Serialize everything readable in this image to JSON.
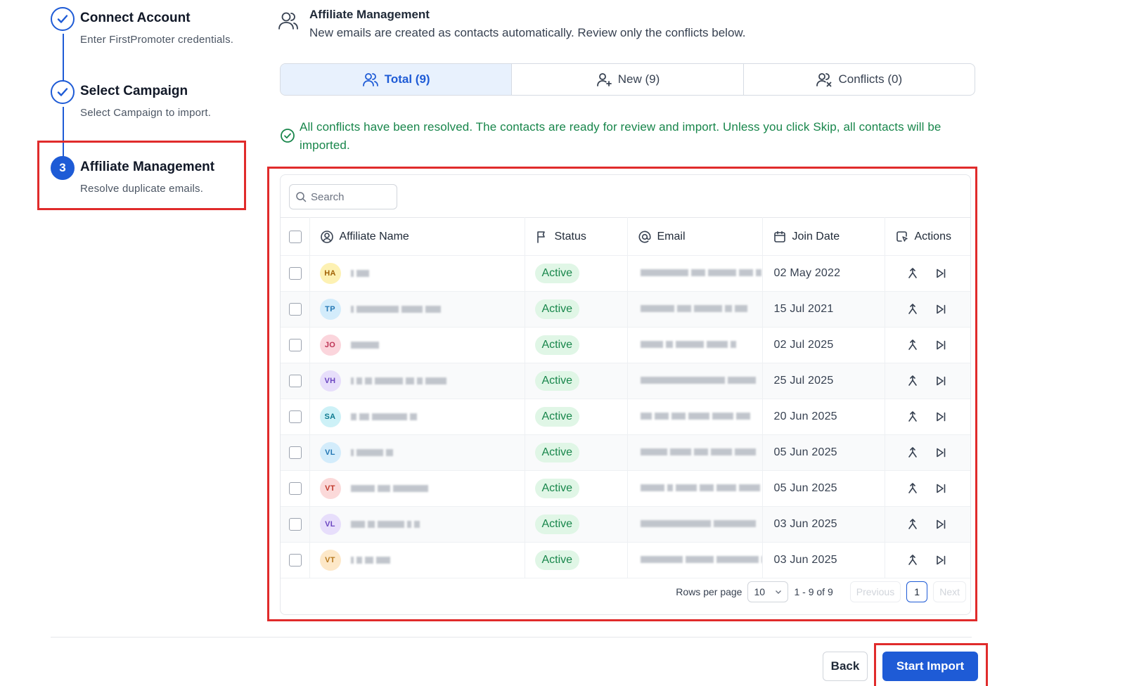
{
  "stepper": {
    "steps": [
      {
        "title": "Connect Account",
        "desc": "Enter FirstPromoter credentials.",
        "state": "completed"
      },
      {
        "title": "Select Campaign",
        "desc": "Select Campaign to import.",
        "state": "completed"
      },
      {
        "number": "3",
        "title": "Affiliate Management",
        "desc": "Resolve duplicate emails.",
        "state": "active"
      }
    ]
  },
  "header": {
    "icon": "users-icon",
    "title": "Affiliate Management",
    "subtitle": "New emails are created as contacts automatically. Review only the conflicts below."
  },
  "tabs": [
    {
      "label": "Total (9)",
      "icon": "users-icon",
      "active": true
    },
    {
      "label": "New (9)",
      "icon": "user-plus-icon",
      "active": false
    },
    {
      "label": "Conflicts (0)",
      "icon": "user-x-icon",
      "active": false
    }
  ],
  "notice": {
    "icon": "check-circle-icon",
    "text": "All conflicts have been resolved. The contacts are ready for review and import. Unless you click Skip, all contacts will be imported."
  },
  "search": {
    "placeholder": "Search"
  },
  "table": {
    "columns": [
      "Affiliate Name",
      "Status",
      "Email",
      "Join Date",
      "Actions"
    ],
    "rows": [
      {
        "initials": "HA",
        "status": "Active",
        "join_date": "02 May 2022"
      },
      {
        "initials": "TP",
        "status": "Active",
        "join_date": "15 Jul 2021"
      },
      {
        "initials": "JO",
        "status": "Active",
        "join_date": "02 Jul 2025"
      },
      {
        "initials": "VH",
        "status": "Active",
        "join_date": "25 Jul 2025"
      },
      {
        "initials": "SA",
        "status": "Active",
        "join_date": "20 Jun 2025"
      },
      {
        "initials": "VL",
        "status": "Active",
        "join_date": "05 Jun 2025"
      },
      {
        "initials": "VT",
        "status": "Active",
        "join_date": "05 Jun 2025"
      },
      {
        "initials": "VL",
        "status": "Active",
        "join_date": "03 Jun 2025"
      },
      {
        "initials": "VT",
        "status": "Active",
        "join_date": "03 Jun 2025"
      }
    ]
  },
  "pagination": {
    "rows_label": "Rows per page",
    "rows_value": "10",
    "range": "1 - 9 of 9",
    "previous": "Previous",
    "current_page": "1",
    "next": "Next"
  },
  "footer": {
    "back": "Back",
    "start_import": "Start Import"
  },
  "colors": {
    "accent": "#1e5bd6",
    "success": "#18864b",
    "highlight": "#e02b2b",
    "avatars": {
      "HA": [
        "#fdf1b3",
        "#a16207"
      ],
      "TP": [
        "#d3ecfb",
        "#2478b5"
      ],
      "JO": [
        "#fbd5dc",
        "#be3455"
      ],
      "VH": [
        "#e7defb",
        "#6b46c1"
      ],
      "SA": [
        "#cdf1f7",
        "#0e7a90"
      ],
      "VL": [
        "#d3ecfb",
        "#2478b5"
      ],
      "VT": [
        "#fbd9d9",
        "#c0392b"
      ],
      "VL2": [
        "#e7defb",
        "#6b46c1"
      ],
      "VT2": [
        "#fde8c8",
        "#b7791f"
      ]
    }
  }
}
